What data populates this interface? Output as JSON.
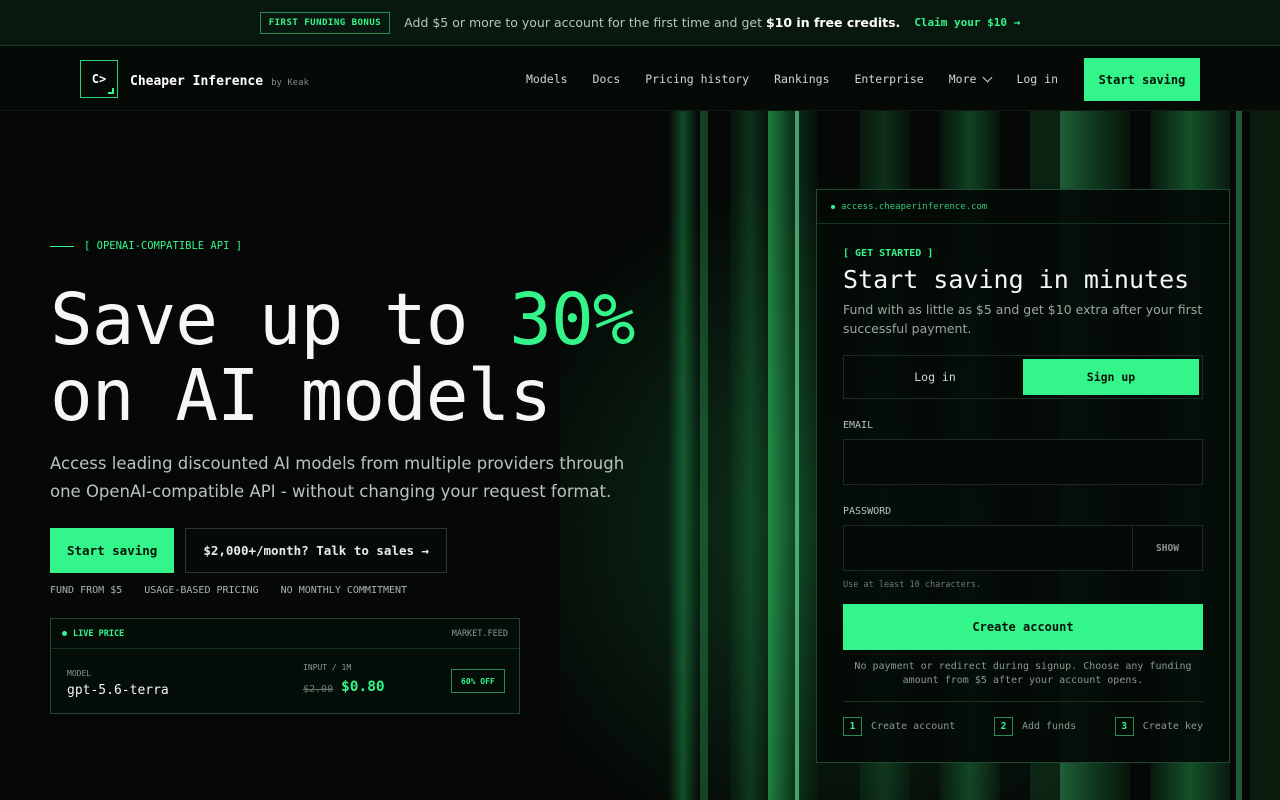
{
  "banner": {
    "badge": "FIRST FUNDING BONUS",
    "text_pre": "Add $5 or more to your account for the first time and get ",
    "text_bold": "$10 in free credits.",
    "link": "Claim your $10 →"
  },
  "header": {
    "logo_mark": "C>",
    "brand": "Cheaper Inference",
    "by": "by Keak",
    "nav": [
      "Models",
      "Docs",
      "Pricing history",
      "Rankings",
      "Enterprise",
      "More",
      "Log in"
    ],
    "cta": "Start saving"
  },
  "hero": {
    "eyebrow": "[ OPENAI-COMPATIBLE API ]",
    "title_line1_pre": "Save up to ",
    "title_accent": "30%",
    "title_line2": "on AI models",
    "subtitle": "Access leading discounted AI models from multiple providers through one OpenAI-compatible API - without changing your request format.",
    "primary_button": "Start saving",
    "secondary_button": "$2,000+/month? Talk to sales →",
    "facts": [
      "FUND FROM $5",
      "USAGE-BASED PRICING",
      "NO MONTHLY COMMITMENT"
    ]
  },
  "live_price": {
    "label": "LIVE PRICE",
    "feed": "MARKET.FEED",
    "model_label": "MODEL",
    "model": "gpt-5.6-terra",
    "price_label": "INPUT / 1M",
    "old_price": "$2.00",
    "new_price": "$0.80",
    "badge": "60% OFF"
  },
  "signup": {
    "url": "access.cheaperinference.com",
    "eyebrow": "[ GET STARTED ]",
    "title": "Start saving in minutes",
    "subtitle": "Fund with as little as $5 and get $10 extra after your first successful payment.",
    "tabs": [
      "Log in",
      "Sign up"
    ],
    "active_tab": "Sign up",
    "email_label": "EMAIL",
    "email_value": "",
    "password_label": "PASSWORD",
    "password_value": "",
    "show": "SHOW",
    "hint": "Use at least 10 characters.",
    "submit": "Create account",
    "note": "No payment or redirect during signup. Choose any funding amount from $5 after your account opens.",
    "steps": [
      {
        "n": "1",
        "label": "Create account"
      },
      {
        "n": "2",
        "label": "Add funds"
      },
      {
        "n": "3",
        "label": "Create key"
      }
    ]
  },
  "colors": {
    "accent": "#34f58a",
    "background": "#050806"
  }
}
